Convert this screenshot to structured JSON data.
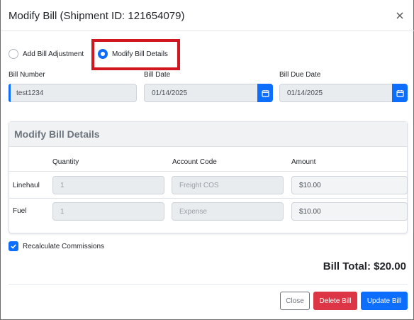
{
  "header": {
    "title": "Modify Bill (Shipment ID: 121654079)"
  },
  "mode": {
    "options": [
      {
        "label": "Add Bill Adjustment",
        "checked": false
      },
      {
        "label": "Modify Bill Details",
        "checked": true
      }
    ]
  },
  "fields": {
    "bill_number": {
      "label": "Bill Number",
      "value": "test1234"
    },
    "bill_date": {
      "label": "Bill Date",
      "value": "01/14/2025"
    },
    "bill_due_date": {
      "label": "Bill Due Date",
      "value": "01/14/2025"
    }
  },
  "details": {
    "title": "Modify Bill Details",
    "columns": [
      "",
      "Quantity",
      "Account Code",
      "Amount"
    ],
    "rows": [
      {
        "label": "Linehaul",
        "quantity": "1",
        "account_code": "Freight COS",
        "amount": "$10.00"
      },
      {
        "label": "Fuel",
        "quantity": "1",
        "account_code": "Expense",
        "amount": "$10.00"
      }
    ]
  },
  "recalculate": {
    "label": "Recalculate Commissions",
    "checked": true
  },
  "total": {
    "label": "Bill Total: $20.00"
  },
  "footer": {
    "close_label": "Close",
    "delete_label": "Delete Bill",
    "update_label": "Update Bill"
  },
  "colors": {
    "primary": "#0d6efd",
    "danger": "#dc3545",
    "highlight": "#d2161f"
  }
}
